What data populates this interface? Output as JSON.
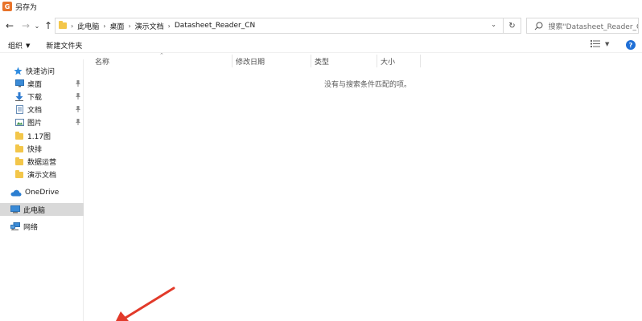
{
  "window": {
    "title": "另存为"
  },
  "address": {
    "breadcrumbs": [
      "此电脑",
      "桌面",
      "演示文档",
      "Datasheet_Reader_CN"
    ]
  },
  "search": {
    "placeholder": "搜索\"Datasheet_Reader_C..."
  },
  "toolbar": {
    "organize_label": "组织",
    "new_folder_label": "新建文件夹"
  },
  "sidebar": {
    "quick_access": "快速访问",
    "items": [
      {
        "label": "桌面",
        "icon": "desktop-icon",
        "pinned": true
      },
      {
        "label": "下载",
        "icon": "download-icon",
        "pinned": true
      },
      {
        "label": "文档",
        "icon": "document-icon",
        "pinned": true
      },
      {
        "label": "图片",
        "icon": "picture-icon",
        "pinned": true
      },
      {
        "label": "1.17图",
        "icon": "folder-icon",
        "pinned": false
      },
      {
        "label": "快排",
        "icon": "folder-icon",
        "pinned": false
      },
      {
        "label": "数据运营",
        "icon": "folder-icon",
        "pinned": false
      },
      {
        "label": "演示文档",
        "icon": "folder-icon",
        "pinned": false
      }
    ],
    "onedrive": "OneDrive",
    "this_pc": "此电脑",
    "network": "网络"
  },
  "columns": [
    "名称",
    "修改日期",
    "类型",
    "大小"
  ],
  "empty_message": "没有与搜索条件匹配的项。",
  "colors": {
    "accent": "#1f6fd6",
    "folder": "#f3c64a",
    "selected": "#d9d9d9",
    "annotation": "#e23a2a"
  }
}
